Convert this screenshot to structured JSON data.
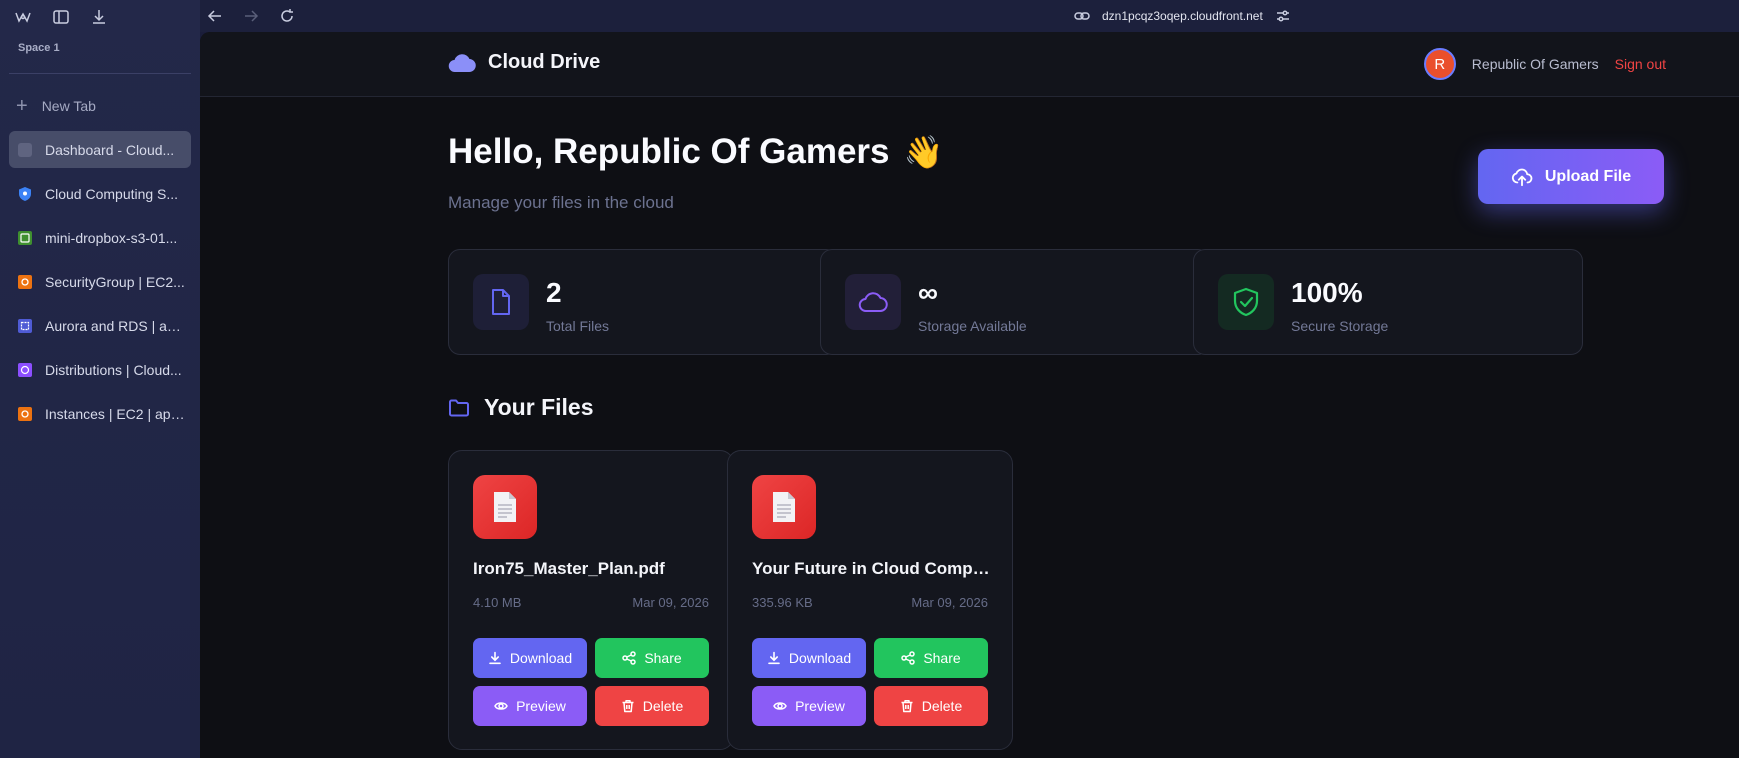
{
  "browser": {
    "space_label": "Space 1",
    "new_tab_label": "New Tab",
    "url": "dzn1pcqz3oqep.cloudfront.net",
    "tabs": [
      {
        "label": "Dashboard - Cloud...",
        "icon": "page-icon",
        "color": "#6b7088",
        "active": true
      },
      {
        "label": "Cloud Computing S...",
        "icon": "shield-icon",
        "color": "#3b82f6",
        "active": false
      },
      {
        "label": "mini-dropbox-s3-01...",
        "icon": "s3-bucket-icon",
        "color": "#3f8f2f",
        "active": false
      },
      {
        "label": "SecurityGroup | EC2...",
        "icon": "ec2-icon",
        "color": "#ec7211",
        "active": false
      },
      {
        "label": "Aurora and RDS | ap...",
        "icon": "rds-icon",
        "color": "#4f5bd5",
        "active": false
      },
      {
        "label": "Distributions | Cloud...",
        "icon": "cloudfront-icon",
        "color": "#8c4fff",
        "active": false
      },
      {
        "label": "Instances | EC2 | ap-...",
        "icon": "ec2-icon",
        "color": "#ec7211",
        "active": false
      }
    ]
  },
  "header": {
    "brand": "Cloud Drive",
    "avatar_initial": "R",
    "user_name": "Republic Of Gamers",
    "sign_out": "Sign out"
  },
  "hero": {
    "greeting": "Hello, Republic Of Gamers",
    "wave": "👋",
    "subtitle": "Manage your files in the cloud",
    "upload_label": "Upload File"
  },
  "stats": [
    {
      "value": "2",
      "label": "Total Files",
      "icon": "file-icon",
      "color": "#6366f1"
    },
    {
      "value": "∞",
      "label": "Storage Available",
      "icon": "cloud-icon",
      "color": "#8b5cf6"
    },
    {
      "value": "100%",
      "label": "Secure Storage",
      "icon": "shield-check-icon",
      "color": "#22c55e"
    }
  ],
  "files_section": {
    "title": "Your Files"
  },
  "files": [
    {
      "name": "Iron75_Master_Plan.pdf",
      "size": "4.10 MB",
      "date": "Mar 09, 2026"
    },
    {
      "name": "Your Future in Cloud Computing",
      "size": "335.96 KB",
      "date": "Mar 09, 2026"
    }
  ],
  "file_actions": {
    "download": "Download",
    "share": "Share",
    "preview": "Preview",
    "delete": "Delete"
  },
  "colors": {
    "accent": "#6366f1",
    "share": "#22c55e",
    "preview": "#8b5cf6",
    "danger": "#ef4444"
  }
}
